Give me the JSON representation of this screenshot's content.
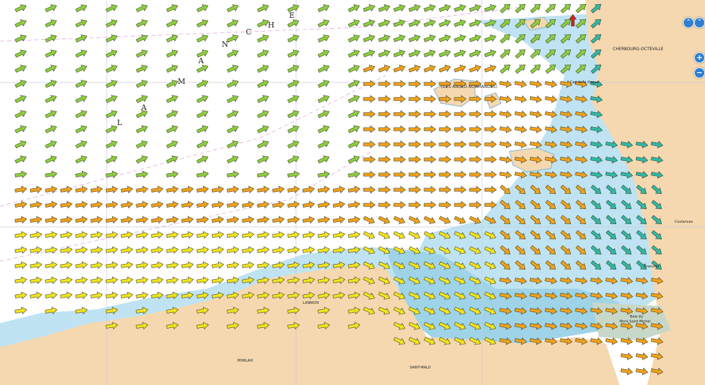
{
  "map": {
    "sea_name_letters": [
      "L",
      "A",
      "M",
      "A",
      "N",
      "C",
      "H",
      "E"
    ],
    "archipelago_label": "(ILES ANGLO-NORMANDES)",
    "cities": [
      "CHERBOURG-OCTEVILLE",
      "SAINT-MALO",
      "LANNION",
      "MORLAIX",
      "Mont Saint-Michel",
      "Baie du",
      "Granville",
      "Coutances",
      "Cap de la Hague"
    ],
    "colors": {
      "sea_open": "#ffffff",
      "sea_shallow": "#bfe3f2",
      "sea_intertidal": "#9fd3e8",
      "land": "#f5d8b0",
      "tidal_flat": "#c8d8c8",
      "arrow_yellow": "#f2e41f",
      "arrow_orange": "#f2a21a",
      "arrow_green": "#8ccf3e",
      "arrow_teal": "#2fb9a8",
      "arrow_red": "#d42020",
      "control_blue": "#2f7fd0"
    }
  },
  "controls": {
    "pan_up": "˄",
    "pan_down": "˅",
    "zoom_in": "+",
    "zoom_out": "−"
  }
}
